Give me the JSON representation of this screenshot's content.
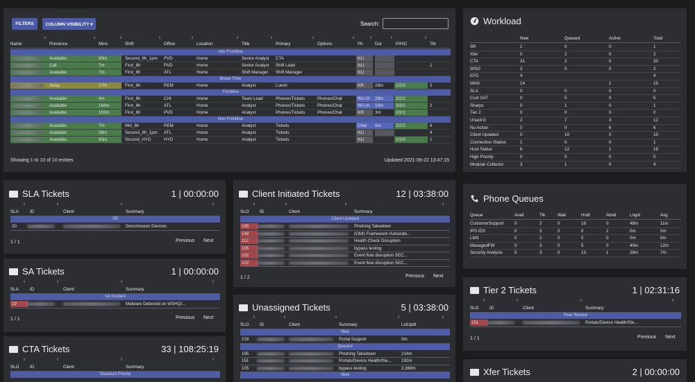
{
  "agents": {
    "filters_label": "FILTERS",
    "colvis_label": "COLUMN VISIBILITY ▾",
    "search_label": "Search:",
    "search_value": "",
    "columns": [
      "Name",
      "Presence",
      "Mins",
      "Shift",
      "Office",
      "Location",
      "Title",
      "Primary",
      "Options",
      "Ph",
      "Dur",
      "P/H/C",
      "Tkt"
    ],
    "groups": [
      {
        "label": "Adv Frontline",
        "rows": [
          {
            "presence": "Available",
            "mins": "69m",
            "shift": "Second_8h_1pm",
            "office": "PVD",
            "location": "Home",
            "title": "Senior Analyst",
            "primary": "CTA",
            "options": "",
            "ph": "NLI",
            "dur": "",
            "phc": "",
            "tkt": ""
          },
          {
            "presence": "Call",
            "mins": "7m",
            "shift": "First_8h",
            "office": "PVD",
            "location": "Home",
            "title": "Senior Analyst",
            "primary": "Shift Lead",
            "options": "",
            "ph": "NLI",
            "dur": "",
            "phc": "",
            "tkt": "1"
          },
          {
            "presence": "Available",
            "mins": "7m",
            "shift": "First_8h",
            "office": "ATL",
            "location": "Home",
            "title": "Shift Manager",
            "primary": "Shift Manager",
            "options": "",
            "ph": "NLI",
            "dur": "",
            "phc": "",
            "tkt": ""
          }
        ]
      },
      {
        "label": "Break Time",
        "rows": [
          {
            "presence": "Away",
            "mins": "17m",
            "shift": "First_8h",
            "office": "REM",
            "location": "Home",
            "title": "Analyst",
            "primary": "Lunch",
            "options": "",
            "ph": "NR",
            "dur": "28m",
            "phc": "2/2/3",
            "tkt": "2"
          }
        ]
      },
      {
        "label": "Frontline",
        "rows": [
          {
            "presence": "Available",
            "mins": "4m",
            "shift": "First_8h",
            "office": "CHI",
            "location": "Home",
            "title": "Team Lead",
            "primary": "Phones/Tickets",
            "options": "Phones/Chat",
            "ph": "WU-O",
            "dur": "29m",
            "phc": "2/2/1",
            "tkt": ""
          },
          {
            "presence": "Available",
            "mins": "164m",
            "shift": "First_8h",
            "office": "ATL",
            "location": "Home",
            "title": "Analyst",
            "primary": "Phones/Tickets",
            "options": "Phones/Chat",
            "ph": "WU-In",
            "dur": "10m",
            "phc": "3/3/1",
            "tkt": "2"
          },
          {
            "presence": "Available",
            "mins": "102m",
            "shift": "First_8h",
            "office": "PVD",
            "location": "Home",
            "title": "Analyst",
            "primary": "Phones/Tickets",
            "options": "Phones/Chat",
            "ph": "NR",
            "dur": "3m",
            "phc": "2/2/1",
            "tkt": ""
          }
        ]
      },
      {
        "label": "Non Frontline",
        "rows": [
          {
            "presence": "Available",
            "mins": "7m",
            "shift": "Mid_8h",
            "office": "REM",
            "location": "Home",
            "title": "Analyst",
            "primary": "Tickets",
            "options": "",
            "ph": "Chat",
            "dur": "5m",
            "phc": "2/2/2",
            "tkt": "6"
          },
          {
            "presence": "Available",
            "mins": "28m",
            "shift": "Second_8h_1pm",
            "office": "ATL",
            "location": "Home",
            "title": "Analyst",
            "primary": "Tickets",
            "options": "",
            "ph": "NLI",
            "dur": "",
            "phc": "",
            "tkt": "4"
          },
          {
            "presence": "Available",
            "mins": "65m",
            "shift": "Second_HYD",
            "office": "HYD",
            "location": "Home",
            "title": "Analyst",
            "primary": "Tickets",
            "options": "",
            "ph": "NLI",
            "dur": "",
            "phc": "1/1/0",
            "tkt": "1"
          }
        ]
      }
    ],
    "showing": "Showing 1 to 10 of 10 entries",
    "updated": "Updated 2021-09-22 13:47:15"
  },
  "workload": {
    "title": "Workload",
    "columns": [
      "",
      "New",
      "Queued",
      "Active",
      "Total"
    ],
    "rows": [
      [
        "SR",
        "1",
        "0",
        "0",
        "1"
      ],
      [
        "Xfer",
        "0",
        "2",
        "0",
        "2"
      ],
      [
        "CTA",
        "31",
        "2",
        "0",
        "33"
      ],
      [
        "WSO",
        "2",
        "0",
        "0",
        "2"
      ],
      [
        "EFD",
        "4",
        "",
        "",
        "4"
      ],
      [
        "MAN",
        "14",
        "",
        "1",
        "15"
      ],
      [
        "SLA",
        "0",
        "0",
        "0",
        "0"
      ],
      [
        "Cust SAT",
        "0",
        "5",
        "0",
        "5"
      ],
      [
        "Sharps",
        "0",
        "1",
        "0",
        "1"
      ],
      [
        "Tier 2",
        "0",
        "0",
        "0",
        "0"
      ],
      [
        "Unack'd",
        "2",
        "7",
        "3",
        "12"
      ],
      [
        "No Action",
        "0",
        "0",
        "6",
        "6"
      ],
      [
        "Client Updated",
        "0",
        "10",
        "0",
        "10"
      ],
      [
        "Connection Station",
        "1",
        "0",
        "0",
        "1"
      ],
      [
        "Host Status",
        "6",
        "12",
        "1",
        "19"
      ],
      [
        "High Priority",
        "0",
        "0",
        "0",
        "0"
      ],
      [
        "Modular Collector",
        "3",
        "1",
        "0",
        "4"
      ]
    ]
  },
  "phone": {
    "title": "Phone Queues",
    "columns": [
      "Queue",
      "Avail",
      "Tlk",
      "Wait",
      "Hndl",
      "Abnd",
      "Lngst",
      "Avg"
    ],
    "rows": [
      [
        "CustomerSupport",
        "0",
        "2",
        "0",
        "18",
        "0",
        "48m",
        "11m"
      ],
      [
        "IPS IDS",
        "0",
        "3",
        "0",
        "0",
        "2",
        "0m",
        "0m"
      ],
      [
        "LMS",
        "0",
        "2",
        "0",
        "0",
        "0",
        "0m",
        "0m"
      ],
      [
        "ManagedFW",
        "0",
        "3",
        "0",
        "5",
        "0",
        "40m",
        "12m"
      ],
      [
        "Security Analysis",
        "5",
        "3",
        "0",
        "13",
        "1",
        "28m",
        "7m"
      ]
    ]
  },
  "sla": {
    "title": "SLA Tickets",
    "stat": "1 | 00:00:00",
    "columns": [
      "SLA",
      "ID",
      "Client",
      "Summary"
    ],
    "section": "SR",
    "rows": [
      {
        "a": "20",
        "summary": "Decomission Devices"
      }
    ],
    "page": "1 / 1",
    "prev": "Previous",
    "next": "Next"
  },
  "sa": {
    "title": "SA Tickets",
    "stat": "1 | 00:00:00",
    "columns": [
      "SLA",
      "ID",
      "Client",
      "Summary"
    ],
    "section": "SA Incident",
    "rows": [
      {
        "a": "19",
        "summary": "Malware Detected on WSHQI..."
      }
    ],
    "page": "1 / 1",
    "prev": "Previous",
    "next": "Next"
  },
  "cta": {
    "title": "CTA Tickets",
    "stat": "33 | 108:25:19",
    "columns": [
      "SLO",
      "ID",
      "Client",
      "Summary"
    ],
    "section": "Standard Priority"
  },
  "client": {
    "title": "Client Initiated Tickets",
    "stat": "12 | 03:38:00",
    "columns": [
      "SLO",
      "ID",
      "Client",
      "Summary"
    ],
    "section": "Client Updated",
    "rows": [
      {
        "a": "195",
        "summary": "Phishing Takedown"
      },
      {
        "a": "149",
        "summary": "(OMI) Framework Vulnerabi.."
      },
      {
        "a": "112",
        "summary": "Health Check Disruption"
      },
      {
        "a": "105",
        "summary": "bypass testing"
      },
      {
        "a": "102",
        "summary": "Event flow disruption SEC..."
      },
      {
        "a": "102",
        "summary": "Event flow disruption SEC..."
      }
    ],
    "page": "1 / 2",
    "prev": "Previous",
    "next": "Next"
  },
  "unassigned": {
    "title": "Unassigned Tickets",
    "stat": "5 | 03:38:00",
    "columns": [
      "SLO",
      "ID",
      "Client",
      "Summary",
      "LstUpdt"
    ],
    "section1": "New",
    "section2": "Queued",
    "section3": "New",
    "rows1": [
      {
        "a": "218",
        "summary": "Portal Support",
        "upd": "0m"
      }
    ],
    "rows2": [
      {
        "a": "195",
        "summary": "Phishing Takedown",
        "upd": "214m"
      },
      {
        "a": "151",
        "summary": "Portals/Device Health/ISe...",
        "upd": "192m"
      },
      {
        "a": "105",
        "summary": "bypass testing",
        "upd": "2,368m"
      }
    ]
  },
  "tier2": {
    "title": "Tier 2 Tickets",
    "stat": "1 | 02:31:16",
    "columns": [
      "SLO",
      "ID",
      "Client",
      "Summary"
    ],
    "section": "Peer Review",
    "rows": [
      {
        "a": "151",
        "summary": "Portals/Device Health/ISe..."
      }
    ],
    "page": "1 / 1",
    "prev": "Previous",
    "next": "Next"
  },
  "xfer": {
    "title": "Xfer Tickets",
    "stat": "2 | 00:00:00"
  },
  "colors": {
    "available": "#4a7c4b",
    "away": "#8c8a3e",
    "section": "#4e5ba7",
    "ph_blue": "#5566b6",
    "slo_red": "#a4454a",
    "panel": "#2d2e31"
  }
}
